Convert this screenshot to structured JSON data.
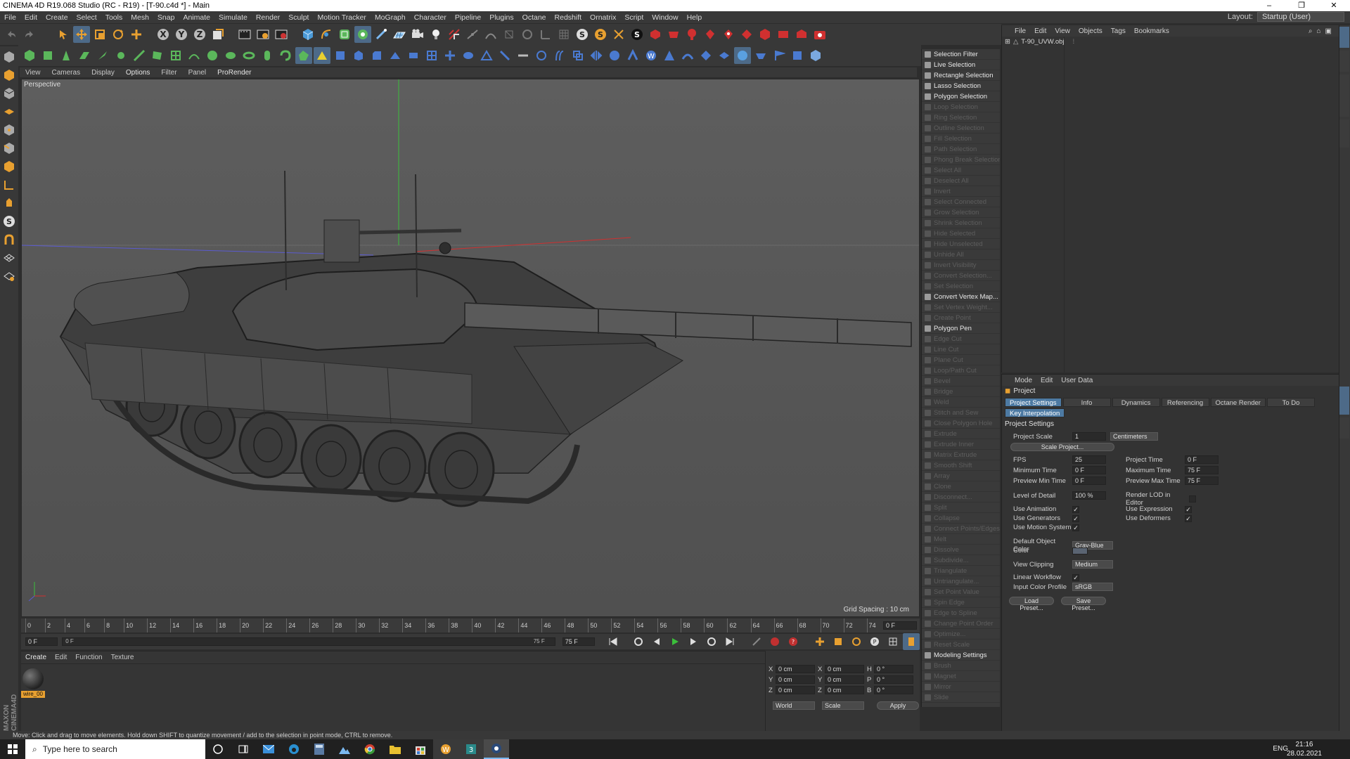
{
  "window": {
    "title": "CINEMA 4D R19.068 Studio (RC - R19) - [T-90.c4d *] - Main",
    "controls": [
      "–",
      "❐",
      "✕"
    ]
  },
  "menubar": {
    "items": [
      "File",
      "Edit",
      "Create",
      "Select",
      "Tools",
      "Mesh",
      "Snap",
      "Animate",
      "Simulate",
      "Render",
      "Sculpt",
      "Motion Tracker",
      "MoGraph",
      "Character",
      "Pipeline",
      "Plugins",
      "Octane",
      "Redshift",
      "Ornatrix",
      "Script",
      "Window",
      "Help"
    ],
    "layout_label": "Layout:",
    "layout_value": "Startup (User)"
  },
  "viewport": {
    "menu": [
      "View",
      "Cameras",
      "Display",
      "Options",
      "Filter",
      "Panel",
      "ProRender"
    ],
    "camera_label": "Perspective",
    "grid_spacing": "Grid Spacing : 10 cm"
  },
  "timeline": {
    "ticks": [
      "0",
      "2",
      "4",
      "6",
      "8",
      "10",
      "12",
      "14",
      "16",
      "18",
      "20",
      "22",
      "24",
      "26",
      "28",
      "30",
      "32",
      "34",
      "36",
      "38",
      "40",
      "42",
      "44",
      "46",
      "48",
      "50",
      "52",
      "54",
      "56",
      "58",
      "60",
      "62",
      "64",
      "66",
      "68",
      "70",
      "72",
      "74"
    ],
    "current_frame": "0 F",
    "start_field": "0 F",
    "range_start": "0 F",
    "range_end": "75 F",
    "end_field": "75 F"
  },
  "material_manager": {
    "menu": [
      "Create",
      "Edit",
      "Function",
      "Texture"
    ],
    "materials": [
      {
        "name": "wire_00"
      }
    ]
  },
  "coordinates": {
    "rows": [
      {
        "axis1": "X",
        "v1": "0 cm",
        "axis2": "X",
        "v2": "0 cm",
        "axis3": "H",
        "v3": "0 °"
      },
      {
        "axis1": "Y",
        "v1": "0 cm",
        "axis2": "Y",
        "v2": "0 cm",
        "axis3": "P",
        "v3": "0 °"
      },
      {
        "axis1": "Z",
        "v1": "0 cm",
        "axis2": "Z",
        "v2": "0 cm",
        "axis3": "B",
        "v3": "0 °"
      }
    ],
    "mode_dropdown": "World",
    "size_dropdown": "Scale",
    "apply_label": "Apply"
  },
  "command_panel": {
    "items": [
      {
        "label": "Selection Filter",
        "enabled": true
      },
      {
        "label": "Live Selection",
        "enabled": true
      },
      {
        "label": "Rectangle Selection",
        "enabled": true
      },
      {
        "label": "Lasso Selection",
        "enabled": true
      },
      {
        "label": "Polygon Selection",
        "enabled": true
      },
      {
        "label": "Loop Selection",
        "enabled": false
      },
      {
        "label": "Ring Selection",
        "enabled": false
      },
      {
        "label": "Outline Selection",
        "enabled": false
      },
      {
        "label": "Fill Selection",
        "enabled": false
      },
      {
        "label": "Path Selection",
        "enabled": false
      },
      {
        "label": "Phong Break Selection",
        "enabled": false
      },
      {
        "label": "Select All",
        "enabled": false
      },
      {
        "label": "Deselect All",
        "enabled": false
      },
      {
        "label": "Invert",
        "enabled": false
      },
      {
        "label": "Select Connected",
        "enabled": false
      },
      {
        "label": "Grow Selection",
        "enabled": false
      },
      {
        "label": "Shrink Selection",
        "enabled": false
      },
      {
        "label": "Hide Selected",
        "enabled": false
      },
      {
        "label": "Hide Unselected",
        "enabled": false
      },
      {
        "label": "Unhide All",
        "enabled": false
      },
      {
        "label": "Invert Visibility",
        "enabled": false
      },
      {
        "label": "Convert Selection...",
        "enabled": false
      },
      {
        "label": "Set Selection",
        "enabled": false
      },
      {
        "label": "Convert Vertex Map...",
        "enabled": true
      },
      {
        "label": "Set Vertex Weight...",
        "enabled": false
      },
      {
        "label": "Create Point",
        "enabled": false
      },
      {
        "label": "Polygon Pen",
        "enabled": true
      },
      {
        "label": "Edge Cut",
        "enabled": false
      },
      {
        "label": "Line Cut",
        "enabled": false
      },
      {
        "label": "Plane Cut",
        "enabled": false
      },
      {
        "label": "Loop/Path Cut",
        "enabled": false
      },
      {
        "label": "Bevel",
        "enabled": false
      },
      {
        "label": "Bridge",
        "enabled": false
      },
      {
        "label": "Weld",
        "enabled": false
      },
      {
        "label": "Stitch and Sew",
        "enabled": false
      },
      {
        "label": "Close Polygon Hole",
        "enabled": false
      },
      {
        "label": "Extrude",
        "enabled": false
      },
      {
        "label": "Extrude Inner",
        "enabled": false
      },
      {
        "label": "Matrix Extrude",
        "enabled": false
      },
      {
        "label": "Smooth Shift",
        "enabled": false
      },
      {
        "label": "Array",
        "enabled": false
      },
      {
        "label": "Clone",
        "enabled": false
      },
      {
        "label": "Disconnect...",
        "enabled": false
      },
      {
        "label": "Split",
        "enabled": false
      },
      {
        "label": "Collapse",
        "enabled": false
      },
      {
        "label": "Connect Points/Edges",
        "enabled": false
      },
      {
        "label": "Melt",
        "enabled": false
      },
      {
        "label": "Dissolve",
        "enabled": false
      },
      {
        "label": "Subdivide...",
        "enabled": false
      },
      {
        "label": "Triangulate",
        "enabled": false
      },
      {
        "label": "Untriangulate...",
        "enabled": false
      },
      {
        "label": "Set Point Value",
        "enabled": false
      },
      {
        "label": "Spin Edge",
        "enabled": false
      },
      {
        "label": "Edge to Spline",
        "enabled": false
      },
      {
        "label": "Change Point Order",
        "enabled": false
      },
      {
        "label": "Optimize...",
        "enabled": false
      },
      {
        "label": "Reset Scale",
        "enabled": false
      },
      {
        "label": "Modeling Settings",
        "enabled": true
      },
      {
        "label": "Brush",
        "enabled": false
      },
      {
        "label": "Magnet",
        "enabled": false
      },
      {
        "label": "Mirror",
        "enabled": false
      },
      {
        "label": "Slide",
        "enabled": false
      }
    ]
  },
  "object_manager": {
    "menu": [
      "File",
      "Edit",
      "View",
      "Objects",
      "Tags",
      "Bookmarks"
    ],
    "objects": [
      {
        "name": "T-90_UVW.obj"
      }
    ]
  },
  "attribute_manager": {
    "menu": [
      "Mode",
      "Edit",
      "User Data"
    ],
    "object_label": "Project",
    "tabs": [
      {
        "label": "Project Settings",
        "selected": true
      },
      {
        "label": "Info",
        "selected": false
      },
      {
        "label": "Dynamics",
        "selected": false
      },
      {
        "label": "Referencing",
        "selected": false
      },
      {
        "label": "Octane Render",
        "selected": false
      },
      {
        "label": "To Do",
        "selected": false
      }
    ],
    "tab2": "Key Interpolation",
    "section": "Project Settings",
    "project_scale_label": "Project Scale",
    "project_scale_value": "1",
    "project_scale_unit": "Centimeters",
    "scale_project_button": "Scale Project...",
    "fps_label": "FPS",
    "fps_value": "25",
    "project_time_label": "Project Time",
    "project_time_value": "0 F",
    "min_time_label": "Minimum Time",
    "min_time_value": "0 F",
    "max_time_label": "Maximum Time",
    "max_time_value": "75 F",
    "preview_min_label": "Preview Min Time",
    "preview_min_value": "0 F",
    "preview_max_label": "Preview Max Time",
    "preview_max_value": "75 F",
    "lod_label": "Level of Detail",
    "lod_value": "100 %",
    "render_lod_label": "Render LOD in Editor",
    "use_animation_label": "Use Animation",
    "use_expression_label": "Use Expression",
    "use_generators_label": "Use Generators",
    "use_deformers_label": "Use Deformers",
    "use_motion_label": "Use Motion System",
    "default_color_label": "Default Object Color",
    "default_color_value": "Gray-Blue",
    "color_label": "Color",
    "view_clipping_label": "View Clipping",
    "view_clipping_value": "Medium",
    "linear_workflow_label": "Linear Workflow",
    "input_profile_label": "Input Color Profile",
    "input_profile_value": "sRGB",
    "load_preset": "Load Preset...",
    "save_preset": "Save Preset..."
  },
  "status": "Move: Click and drag to move elements. Hold down SHIFT to quantize movement / add to the selection in point mode, CTRL to remove.",
  "taskbar": {
    "search_placeholder": "Type here to search",
    "language": "ENG",
    "time": "21:16",
    "date": "28.02.2021"
  },
  "colors": {
    "accent": "#4d7aa3",
    "active_icon": "#4d6a88",
    "red_tool": "#d03030"
  }
}
